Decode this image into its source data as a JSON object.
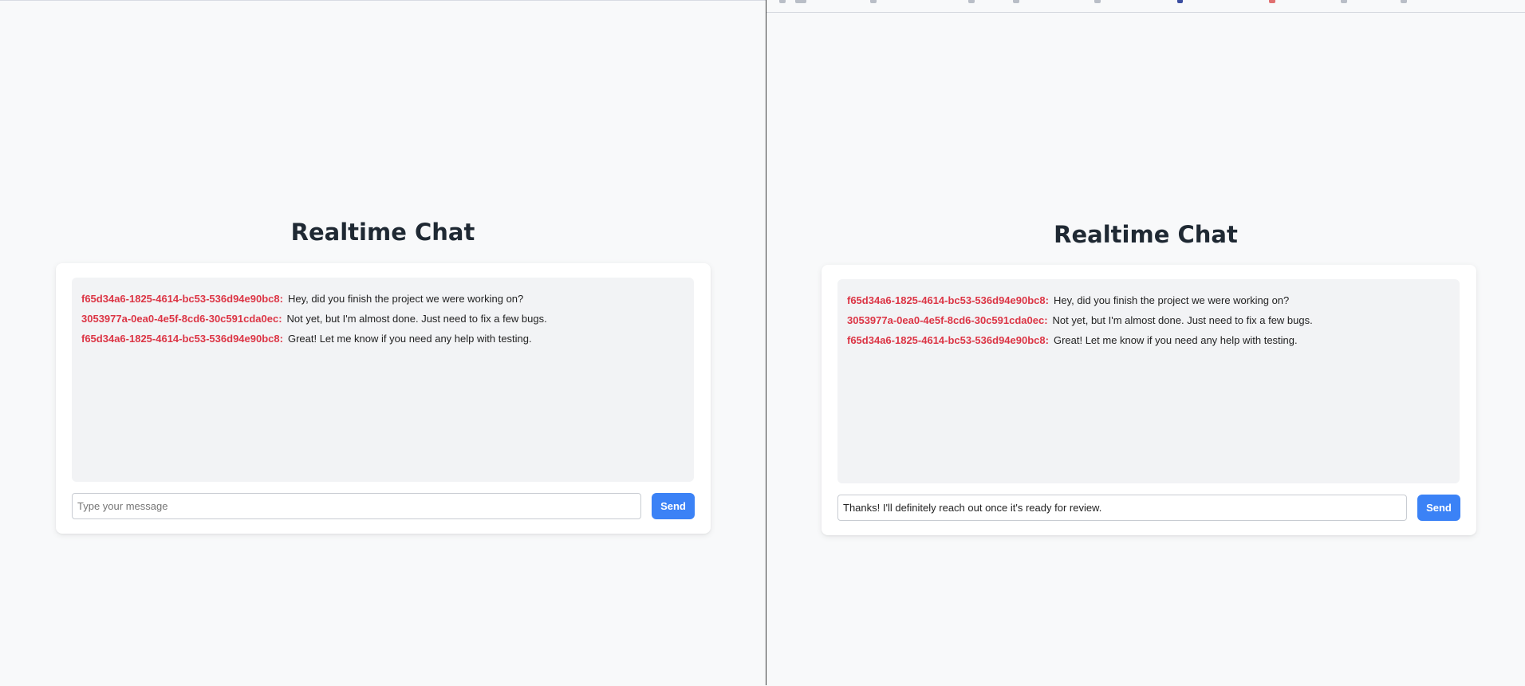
{
  "windows": [
    {
      "title": "Realtime Chat",
      "messages": [
        {
          "user": "f65d34a6-1825-4614-bc53-536d94e90bc8:",
          "text": "Hey, did you finish the project we were working on?"
        },
        {
          "user": "3053977a-0ea0-4e5f-8cd6-30c591cda0ec:",
          "text": "Not yet, but I'm almost done. Just need to fix a few bugs."
        },
        {
          "user": "f65d34a6-1825-4614-bc53-536d94e90bc8:",
          "text": "Great! Let me know if you need any help with testing."
        }
      ],
      "input": {
        "value": "",
        "placeholder": "Type your message"
      },
      "send_label": "Send"
    },
    {
      "title": "Realtime Chat",
      "messages": [
        {
          "user": "f65d34a6-1825-4614-bc53-536d94e90bc8:",
          "text": "Hey, did you finish the project we were working on?"
        },
        {
          "user": "3053977a-0ea0-4e5f-8cd6-30c591cda0ec:",
          "text": "Not yet, but I'm almost done. Just need to fix a few bugs."
        },
        {
          "user": "f65d34a6-1825-4614-bc53-536d94e90bc8:",
          "text": "Great! Let me know if you need any help with testing."
        }
      ],
      "input": {
        "value": "Thanks! I'll definitely reach out once it's ready for review.",
        "placeholder": "Type your message"
      },
      "send_label": "Send"
    }
  ],
  "colors": {
    "background": "#f8f9fa",
    "username": "#dc3545",
    "send_button": "#3b82f6",
    "messages_panel": "#f2f3f5"
  }
}
